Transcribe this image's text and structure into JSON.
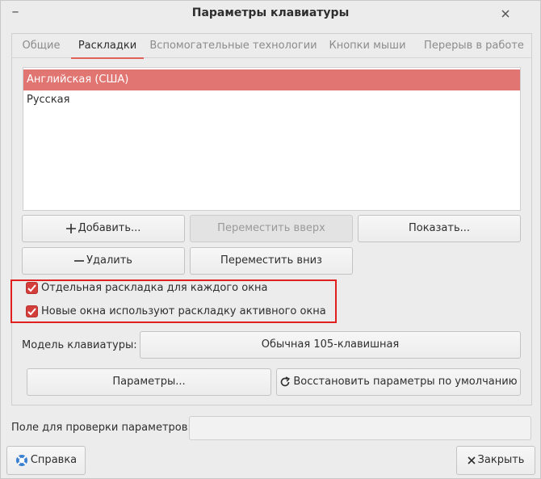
{
  "window": {
    "title": "Параметры клавиатуры",
    "menu_icon": "window-menu-icon",
    "close_icon": "close-icon"
  },
  "tabs": [
    {
      "label": "Общие",
      "active": false
    },
    {
      "label": "Раскладки",
      "active": true
    },
    {
      "label": "Вспомогательные технологии",
      "active": false
    },
    {
      "label": "Кнопки мыши",
      "active": false
    },
    {
      "label": "Перерыв в работе",
      "active": false
    }
  ],
  "layouts": {
    "items": [
      {
        "label": "Английская (США)",
        "selected": true
      },
      {
        "label": "Русская",
        "selected": false
      }
    ]
  },
  "buttons": {
    "add": "Добавить...",
    "move_up": "Переместить вверх",
    "show": "Показать...",
    "remove": "Удалить",
    "move_down": "Переместить вниз",
    "options": "Параметры...",
    "reset": "Восстановить параметры по умолчанию",
    "help": "Справка",
    "close": "Закрыть"
  },
  "checkboxes": {
    "separate_layout": {
      "label": "Отдельная раскладка для каждого окна",
      "checked": true
    },
    "new_windows": {
      "label": "Новые окна используют раскладку активного окна",
      "checked": true
    }
  },
  "keyboard_model": {
    "label": "Модель клавиатуры:",
    "value": "Обычная 105-клавишная"
  },
  "test_field": {
    "label": "Поле для проверки параметров:",
    "value": ""
  },
  "colors": {
    "accent": "#e0615c",
    "selection": "#e17572",
    "checkbox": "#d33d3a",
    "highlight_border": "#e21f1f"
  }
}
